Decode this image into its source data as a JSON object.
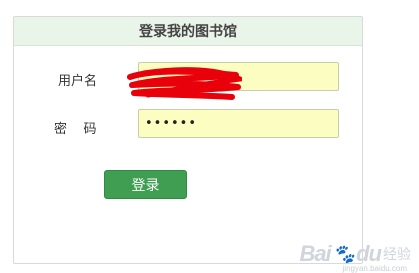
{
  "panel": {
    "title": "登录我的图书馆"
  },
  "form": {
    "username_label": "用户名",
    "username_value": "",
    "password_label": "密    码",
    "password_value": "••••••",
    "submit_label": "登录"
  },
  "watermark": {
    "brand": "Bai",
    "paw": "du",
    "text": "经验",
    "url": "jingyan.baidu.com"
  },
  "colors": {
    "header_bg": "#eaf5ea",
    "input_bg": "#fbfec0",
    "button_bg": "#3f9e52",
    "redaction": "#e8000a"
  }
}
